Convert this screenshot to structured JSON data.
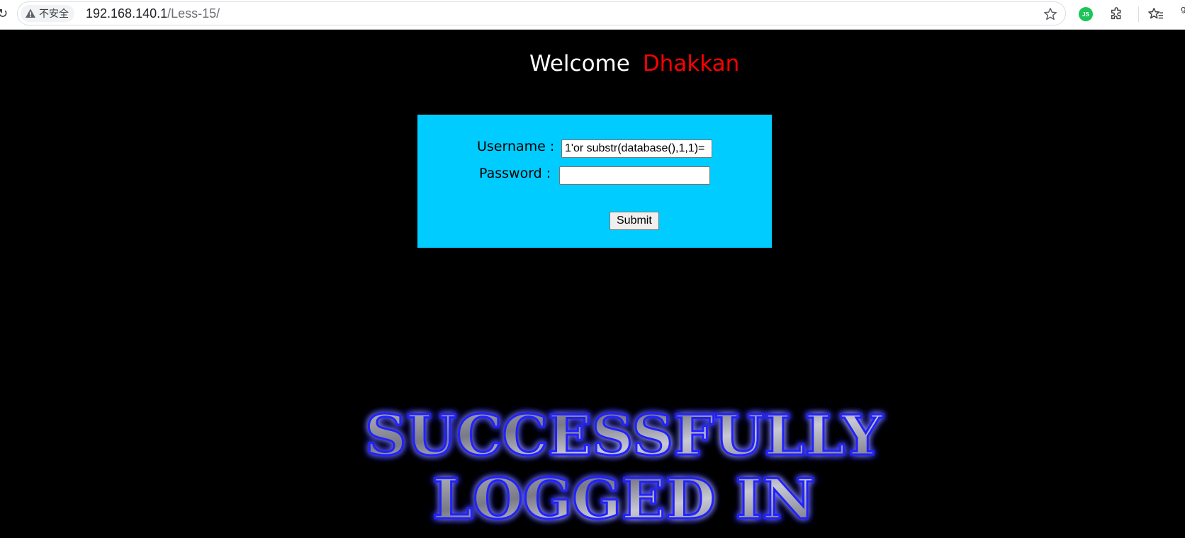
{
  "browser": {
    "security_label": "不安全",
    "url_host": "192.168.140.1",
    "url_path": "/Less-15/",
    "extension_js_label": "JS"
  },
  "page": {
    "welcome_text": "Welcome",
    "welcome_name": "Dhakkan",
    "welcome_name_color": "#ff0000",
    "panel_color": "#00ccff",
    "form": {
      "username_label": "Username :",
      "username_value": "1'or substr(database(),1,1)=",
      "password_label": "Password :",
      "password_value": "",
      "submit_label": "Submit"
    },
    "banner": {
      "line1": "SUCCESSFULLY",
      "line2": "LOGGED IN"
    }
  }
}
